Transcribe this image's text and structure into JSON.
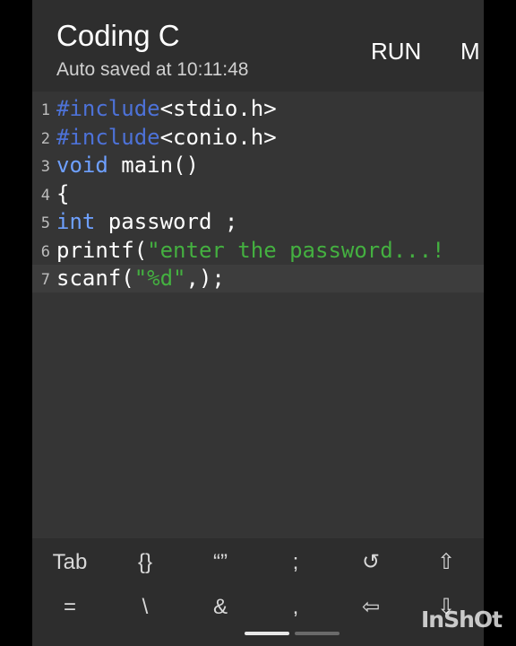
{
  "header": {
    "title": "Coding C",
    "autosave": "Auto saved at 10:11:48",
    "run_label": "RUN",
    "more_label": "M"
  },
  "editor": {
    "lines": [
      {
        "num": "1",
        "tokens": [
          {
            "t": "#include",
            "c": "kw"
          },
          {
            "t": "<stdio.h>",
            "c": ""
          }
        ]
      },
      {
        "num": "2",
        "tokens": [
          {
            "t": "#include",
            "c": "kw"
          },
          {
            "t": "<conio.h>",
            "c": ""
          }
        ]
      },
      {
        "num": "3",
        "tokens": [
          {
            "t": "void",
            "c": "ty"
          },
          {
            "t": " main()",
            "c": ""
          }
        ]
      },
      {
        "num": "4",
        "tokens": [
          {
            "t": "{",
            "c": ""
          }
        ]
      },
      {
        "num": "5",
        "tokens": [
          {
            "t": "int",
            "c": "ty"
          },
          {
            "t": " password ;",
            "c": ""
          }
        ]
      },
      {
        "num": "6",
        "tokens": [
          {
            "t": "printf(",
            "c": ""
          },
          {
            "t": "\"enter the password...!",
            "c": "str"
          }
        ]
      },
      {
        "num": "7",
        "tokens": [
          {
            "t": "scanf(",
            "c": ""
          },
          {
            "t": "\"%d\"",
            "c": "str"
          },
          {
            "t": ",);",
            "c": ""
          }
        ]
      }
    ],
    "active_line": 7
  },
  "keys": {
    "row1": [
      {
        "label": "Tab",
        "name": "key-tab"
      },
      {
        "label": "{}",
        "name": "key-braces"
      },
      {
        "label": "“”",
        "name": "key-quotes"
      },
      {
        "label": ";",
        "name": "key-semicolon"
      },
      {
        "label": "↺",
        "name": "undo-icon"
      },
      {
        "label": "⇧",
        "name": "shift-up-icon"
      }
    ],
    "row2": [
      {
        "label": "=",
        "name": "key-equals"
      },
      {
        "label": "\\",
        "name": "key-backslash"
      },
      {
        "label": "&",
        "name": "key-ampersand"
      },
      {
        "label": ",",
        "name": "key-comma"
      },
      {
        "label": "⇦",
        "name": "arrow-left-icon"
      },
      {
        "label": "⇩",
        "name": "arrow-down-icon"
      }
    ]
  },
  "watermark": "InShOt"
}
